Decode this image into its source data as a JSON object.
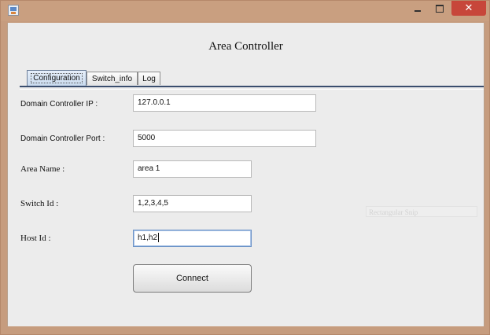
{
  "window": {
    "title_text": "Area Controller",
    "controls": {
      "minimize": "–",
      "maximize": "□",
      "close": "✕"
    },
    "colors": {
      "titlebar": "#c99f80",
      "close_button": "#c7463a",
      "panel": "#ececec"
    }
  },
  "tabs": [
    {
      "label": "Configuration",
      "active": true
    },
    {
      "label": "Switch_info",
      "active": false
    },
    {
      "label": "Log",
      "active": false
    }
  ],
  "form": {
    "domain_ip": {
      "label": "Domain Controller IP :",
      "value": "127.0.0.1"
    },
    "domain_port": {
      "label": "Domain Controller Port :",
      "value": "5000"
    },
    "area_name": {
      "label": "Area Name :",
      "value": "area 1"
    },
    "switch_id": {
      "label": "Switch Id :",
      "value": "1,2,3,4,5"
    },
    "host_id": {
      "label": "Host Id :",
      "value": "h1,h2"
    },
    "connect_label": "Connect"
  },
  "ghost_tooltip": "Rectangular Snip"
}
